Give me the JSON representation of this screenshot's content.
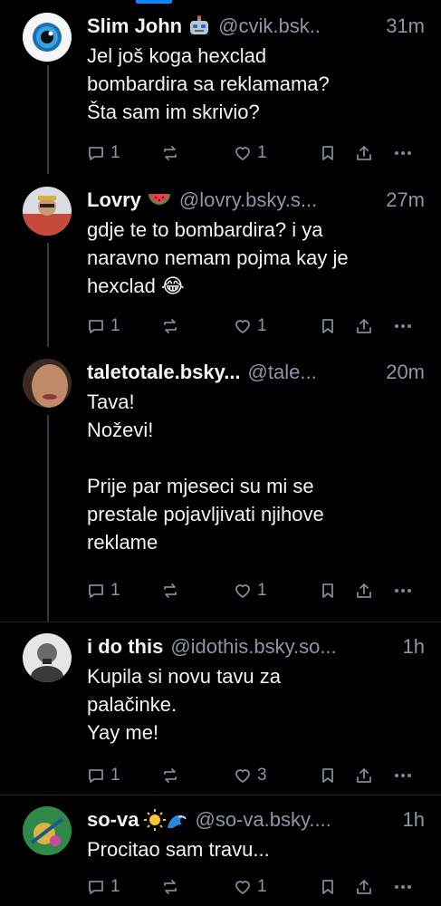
{
  "posts": [
    {
      "name": "Slim John",
      "emoji": "robot",
      "handle": "@cvik.bsk..",
      "time": "31m",
      "text": "Jel još koga hexclad\nbombardira sa reklamama?\nŠta sam im skrivio?",
      "replies": "1",
      "likes": "1"
    },
    {
      "name": "Lovry",
      "emoji": "watermelon",
      "handle": "@lovry.bsky.s...",
      "time": "27m",
      "text": "gdje te to bombardira? i ya\nnaravno nemam pojma kay je\nhexclad 😂",
      "replies": "1",
      "likes": "1"
    },
    {
      "name": "taletotale.bsky...",
      "emoji": "",
      "handle": "@tale...",
      "time": "20m",
      "text": "Tava!\nNoževi!\n\nPrije par mjeseci su mi se\nprestale pojavljivati njihove\nreklame",
      "replies": "1",
      "likes": "1"
    },
    {
      "name": "i do this",
      "emoji": "",
      "handle": "@idothis.bsky.so...",
      "time": "1h",
      "text": "Kupila si novu tavu za\npalačinke.\nYay me!",
      "replies": "1",
      "likes": "3"
    },
    {
      "name": "so-va",
      "emoji": "sun-wave",
      "handle": "@so-va.bsky....",
      "time": "1h",
      "text": "Procitao sam travu...",
      "replies": "1",
      "likes": "1"
    }
  ],
  "colors": {
    "background": "#000000",
    "text": "#f1f3f5",
    "muted": "#8a97a6",
    "accent": "#1083fe",
    "thread_line": "#2e3a47"
  }
}
